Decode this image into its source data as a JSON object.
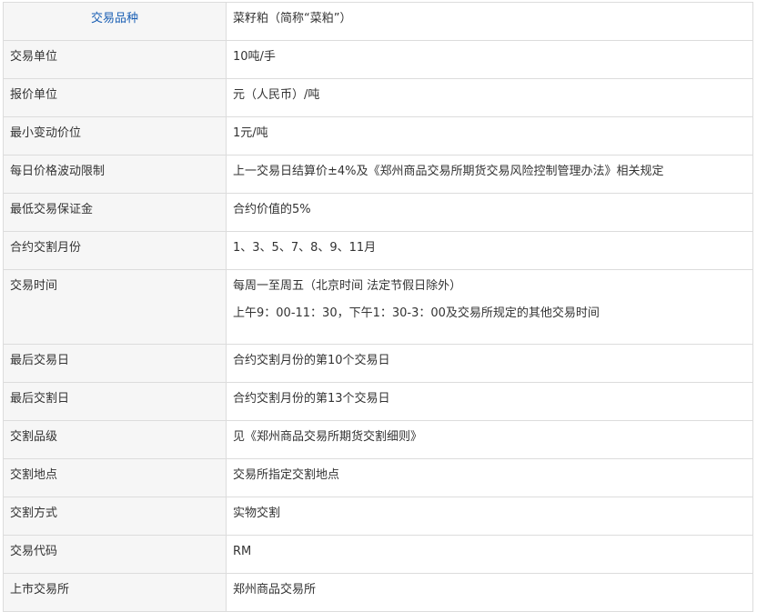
{
  "rows": [
    {
      "label": "交易品种",
      "value": "菜籽粕（简称“菜粕”）"
    },
    {
      "label": "交易单位",
      "value": "10吨/手"
    },
    {
      "label": "报价单位",
      "value": "元（人民币）/吨"
    },
    {
      "label": "最小变动价位",
      "value": "1元/吨"
    },
    {
      "label": "每日价格波动限制",
      "value": "上一交易日结算价±4%及《郑州商品交易所期货交易风险控制管理办法》相关规定"
    },
    {
      "label": "最低交易保证金",
      "value": "合约价值的5%"
    },
    {
      "label": "合约交割月份",
      "value": "1、3、5、7、8、9、11月"
    },
    {
      "label": "交易时间",
      "value": "每周一至周五（北京时间 法定节假日除外）",
      "value2": "上午9：00-11：30，下午1：30-3：00及交易所规定的其他交易时间"
    },
    {
      "label": "最后交易日",
      "value": "合约交割月份的第10个交易日"
    },
    {
      "label": "最后交割日",
      "value": "合约交割月份的第13个交易日"
    },
    {
      "label": "交割品级",
      "value": "见《郑州商品交易所期货交割细则》"
    },
    {
      "label": "交割地点",
      "value": "交易所指定交割地点"
    },
    {
      "label": "交割方式",
      "value": "实物交割"
    },
    {
      "label": "交易代码",
      "value": "RM"
    },
    {
      "label": "上市交易所",
      "value": "郑州商品交易所"
    }
  ],
  "colors": {
    "header_text": "#1a5fb4",
    "label_bg": "#f6f6f6",
    "border": "#dcdcdc",
    "text": "#333333"
  }
}
